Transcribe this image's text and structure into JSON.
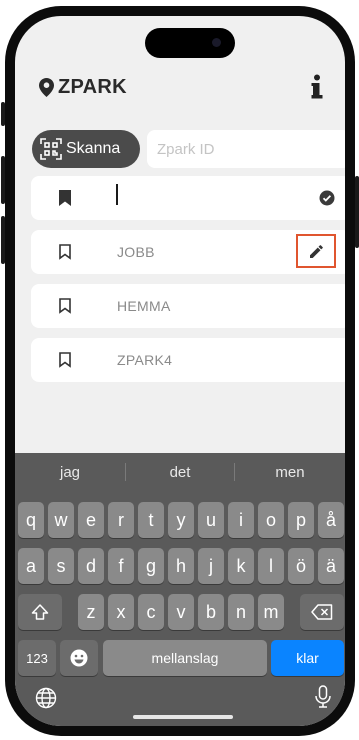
{
  "header": {
    "title": "ZPARK",
    "info_label": "i"
  },
  "search": {
    "scan_label": "Skanna",
    "placeholder": "Zpark ID",
    "value": ""
  },
  "list": {
    "items": [
      {
        "label": "",
        "state": "editing"
      },
      {
        "label": "JOBB"
      },
      {
        "label": "HEMMA"
      },
      {
        "label": "ZPARK4"
      }
    ]
  },
  "keyboard": {
    "suggestions": [
      "jag",
      "det",
      "men"
    ],
    "row1": [
      "q",
      "w",
      "e",
      "r",
      "t",
      "y",
      "u",
      "i",
      "o",
      "p",
      "å"
    ],
    "row2": [
      "a",
      "s",
      "d",
      "f",
      "g",
      "h",
      "j",
      "k",
      "l",
      "ö",
      "ä"
    ],
    "row3": [
      "z",
      "x",
      "c",
      "v",
      "b",
      "n",
      "m"
    ],
    "numbers_label": "123",
    "space_label": "mellanslag",
    "return_label": "klar"
  },
  "colors": {
    "accent_blue": "#0a84ff",
    "edit_highlight": "#e0552f",
    "scan_button": "#4b4b4b"
  }
}
